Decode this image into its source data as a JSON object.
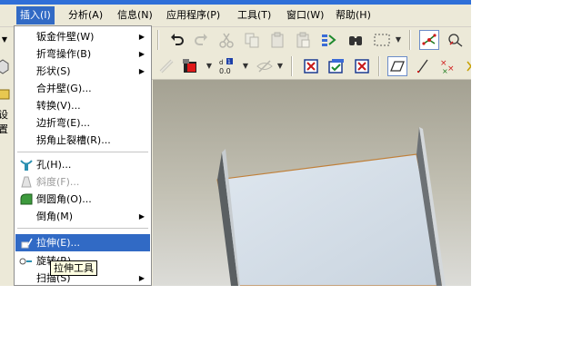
{
  "menubar": {
    "items": [
      "插入(I)",
      "分析(A)",
      "信息(N)",
      "应用程序(P)",
      "工具(T)",
      "窗口(W)",
      "帮助(H)"
    ],
    "active_index": 0
  },
  "insert_menu": {
    "items": [
      {
        "label": "钣金件壁(W)",
        "submenu": true
      },
      {
        "label": "折弯操作(B)",
        "submenu": true
      },
      {
        "label": "形状(S)",
        "submenu": true
      },
      {
        "label": "合并壁(G)...",
        "submenu": false
      },
      {
        "label": "转换(V)...",
        "submenu": false
      },
      {
        "label": "边折弯(E)...",
        "submenu": false
      },
      {
        "label": "拐角止裂槽(R)...",
        "submenu": false
      },
      {
        "label": "孔(H)...",
        "submenu": false,
        "icon": "hole-icon"
      },
      {
        "label": "斜度(F)...",
        "submenu": false,
        "icon": "draft-icon",
        "disabled": true
      },
      {
        "label": "倒圆角(O)...",
        "submenu": false,
        "icon": "round-icon"
      },
      {
        "label": "倒角(M)",
        "submenu": true
      },
      {
        "label": "拉伸(E)...",
        "submenu": false,
        "icon": "extrude-icon",
        "highlighted": true
      },
      {
        "label": "旋转(R)...",
        "submenu": false,
        "icon": "revolve-icon"
      },
      {
        "label": "扫描(S)",
        "submenu": true
      }
    ]
  },
  "tooltip": "拉伸工具",
  "left_panel": {
    "label": "设置"
  },
  "toolbar": {
    "row1": [
      "undo-icon",
      "redo-icon",
      "cut-icon",
      "copy-icon",
      "paste-icon",
      "paste-special-icon",
      "regenerate-icon",
      "find-icon",
      "selection-box-icon",
      "datum-axis-icon",
      "spin-center-icon"
    ],
    "row2": [
      "chain-icon",
      "color-appearance-icon",
      "dimension-format-icon",
      "hide-icon",
      "close-window-icon",
      "window-activate-icon",
      "close-icon",
      "plane-display-icon",
      "axis-display-icon",
      "point-display-icon"
    ],
    "dim_badge": "0.0"
  },
  "colors": {
    "menu_highlight": "#316ac5",
    "toolbar_bg": "#ece9d8",
    "model_face": "#d3dde8",
    "model_edge": "#c0803a"
  }
}
